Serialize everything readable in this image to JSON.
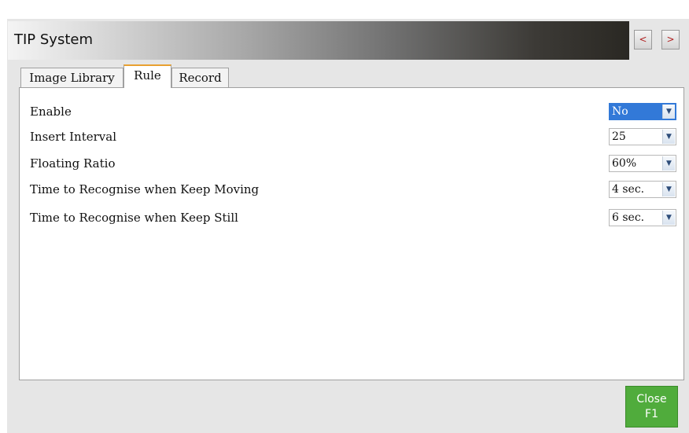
{
  "window": {
    "title": "TIP System",
    "prev_label": "<",
    "next_label": ">"
  },
  "tabs": [
    {
      "label": "Image Library",
      "active": false
    },
    {
      "label": "Rule",
      "active": true
    },
    {
      "label": "Record",
      "active": false
    }
  ],
  "settings": [
    {
      "label": "Enable",
      "value": "No"
    },
    {
      "label": "Insert Interval",
      "value": "25"
    },
    {
      "label": "Floating Ratio",
      "value": "60%"
    },
    {
      "label": "Time to Recognise when Keep Moving",
      "value": "4 sec."
    },
    {
      "label": "Time to Recognise when Keep Still",
      "value": "6 sec."
    }
  ],
  "footer": {
    "close_label": "Close",
    "close_key": "F1"
  },
  "icons": {
    "dropdown": "chevron-down-icon"
  },
  "colors": {
    "selected": "#3279d8",
    "close_button": "#50ac3c",
    "active_tab_accent": "#e8a030"
  }
}
